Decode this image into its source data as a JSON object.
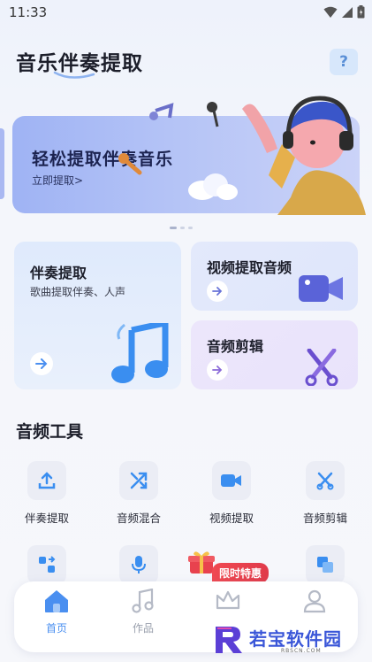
{
  "status": {
    "time": "11:33"
  },
  "header": {
    "title": "音乐伴奏提取",
    "help_label": "?"
  },
  "banner": {
    "title": "轻松提取伴奏音乐",
    "cta": "立即提取>"
  },
  "cards": {
    "accompaniment": {
      "title": "伴奏提取",
      "desc": "歌曲提取伴奏、人声"
    },
    "video_audio": {
      "title": "视频提取音频"
    },
    "audio_edit": {
      "title": "音频剪辑"
    }
  },
  "tools": {
    "section_title": "音频工具",
    "items": [
      {
        "label": "伴奏提取",
        "icon": "upload-icon"
      },
      {
        "label": "音频混合",
        "icon": "shuffle-icon"
      },
      {
        "label": "视频提取",
        "icon": "video-camera-icon"
      },
      {
        "label": "音频剪辑",
        "icon": "scissors-icon"
      }
    ]
  },
  "promo": {
    "label": "限时特惠"
  },
  "tabbar": {
    "items": [
      {
        "label": "首页",
        "icon": "home-icon",
        "active": true
      },
      {
        "label": "作品",
        "icon": "music-note-icon",
        "active": false
      },
      {
        "label": "",
        "icon": "crown-icon",
        "active": false
      },
      {
        "label": "",
        "icon": "user-icon",
        "active": false
      }
    ]
  },
  "watermark": {
    "text": "若宝软件园",
    "sub": "RBSCN.COM"
  },
  "colors": {
    "accent": "#4a8ff0",
    "banner": "#a9b8f2",
    "promo": "#e8424e"
  }
}
